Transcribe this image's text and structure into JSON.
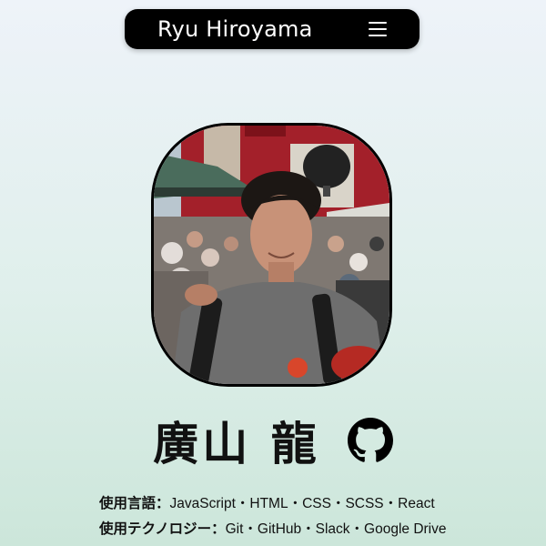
{
  "header": {
    "site_title": "Ryu Hiroyama",
    "menu_icon": "hamburger-menu-icon"
  },
  "profile": {
    "photo_alt": "Ryu Hiroyama profile photo",
    "name": "廣山 龍",
    "github_icon": "github-icon"
  },
  "skills": {
    "languages_label": "使用言語：",
    "languages": "JavaScript・HTML・CSS・SCSS・React",
    "tech_label": "使用テクノロジー：",
    "tech": "Git・GitHub・Slack・Google Drive"
  },
  "colors": {
    "header_bg": "#000000",
    "page_bg_top": "#eef3f9",
    "page_bg_bottom": "#cce6da",
    "text": "#111111"
  }
}
